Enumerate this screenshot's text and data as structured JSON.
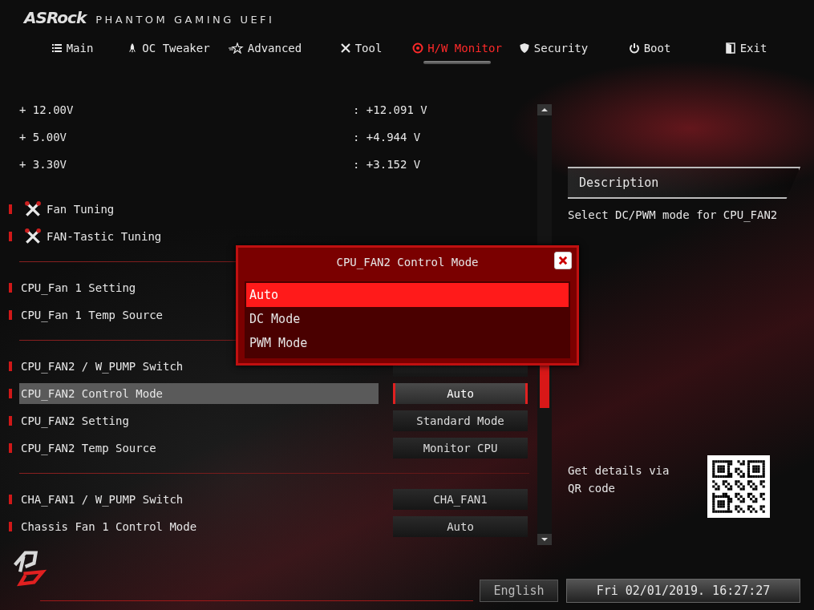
{
  "logo": {
    "brand": "ASRock",
    "product": "PHANTOM GAMING UEFI"
  },
  "tabs": [
    {
      "label": "Main",
      "selected": false
    },
    {
      "label": "OC Tweaker",
      "selected": false
    },
    {
      "label": "Advanced",
      "selected": false
    },
    {
      "label": "Tool",
      "selected": false
    },
    {
      "label": "H/W Monitor",
      "selected": true
    },
    {
      "label": "Security",
      "selected": false
    },
    {
      "label": "Boot",
      "selected": false
    },
    {
      "label": "Exit",
      "selected": false
    }
  ],
  "groups": [
    {
      "items": [
        {
          "kind": "reading",
          "label": "+ 12.00V",
          "value": ": +12.091 V"
        },
        {
          "kind": "reading",
          "label": "+ 5.00V",
          "value": ": +4.944 V"
        },
        {
          "kind": "reading",
          "label": "+ 3.30V",
          "value": ": +3.152 V"
        }
      ]
    },
    {
      "items": [
        {
          "kind": "tool",
          "label": "Fan Tuning"
        },
        {
          "kind": "tool",
          "label": "FAN-Tastic Tuning"
        }
      ]
    },
    {
      "items": [
        {
          "kind": "link",
          "label": "CPU_Fan 1 Setting",
          "selected": false
        },
        {
          "kind": "link",
          "label": "CPU_Fan 1 Temp Source",
          "selected": false
        }
      ]
    },
    {
      "items": [
        {
          "kind": "setting",
          "label": "CPU_FAN2 / W_PUMP Switch",
          "selected": false
        },
        {
          "kind": "setting",
          "label": "CPU_FAN2 Control Mode",
          "value": "Auto",
          "selected": true
        },
        {
          "kind": "setting",
          "label": "CPU_FAN2 Setting",
          "value": "Standard Mode",
          "selected": false
        },
        {
          "kind": "setting",
          "label": "CPU_FAN2 Temp Source",
          "value": "Monitor CPU",
          "selected": false
        }
      ]
    },
    {
      "items": [
        {
          "kind": "setting",
          "label": "CHA_FAN1 / W_PUMP Switch",
          "value": "CHA_FAN1",
          "selected": false
        },
        {
          "kind": "setting",
          "label": "Chassis Fan 1 Control Mode",
          "value": "Auto",
          "selected": false
        }
      ]
    }
  ],
  "popup": {
    "title": "CPU_FAN2 Control Mode",
    "options": [
      {
        "label": "Auto",
        "selected": true
      },
      {
        "label": "DC Mode",
        "selected": false
      },
      {
        "label": "PWM Mode",
        "selected": false
      }
    ]
  },
  "description": {
    "heading": "Description",
    "text": "Select DC/PWM mode for CPU_FAN2"
  },
  "qr": {
    "text": "Get details via QR code"
  },
  "status_bar": {
    "language": "English",
    "datetime": "Fri 02/01/2019. 16:27:27"
  }
}
